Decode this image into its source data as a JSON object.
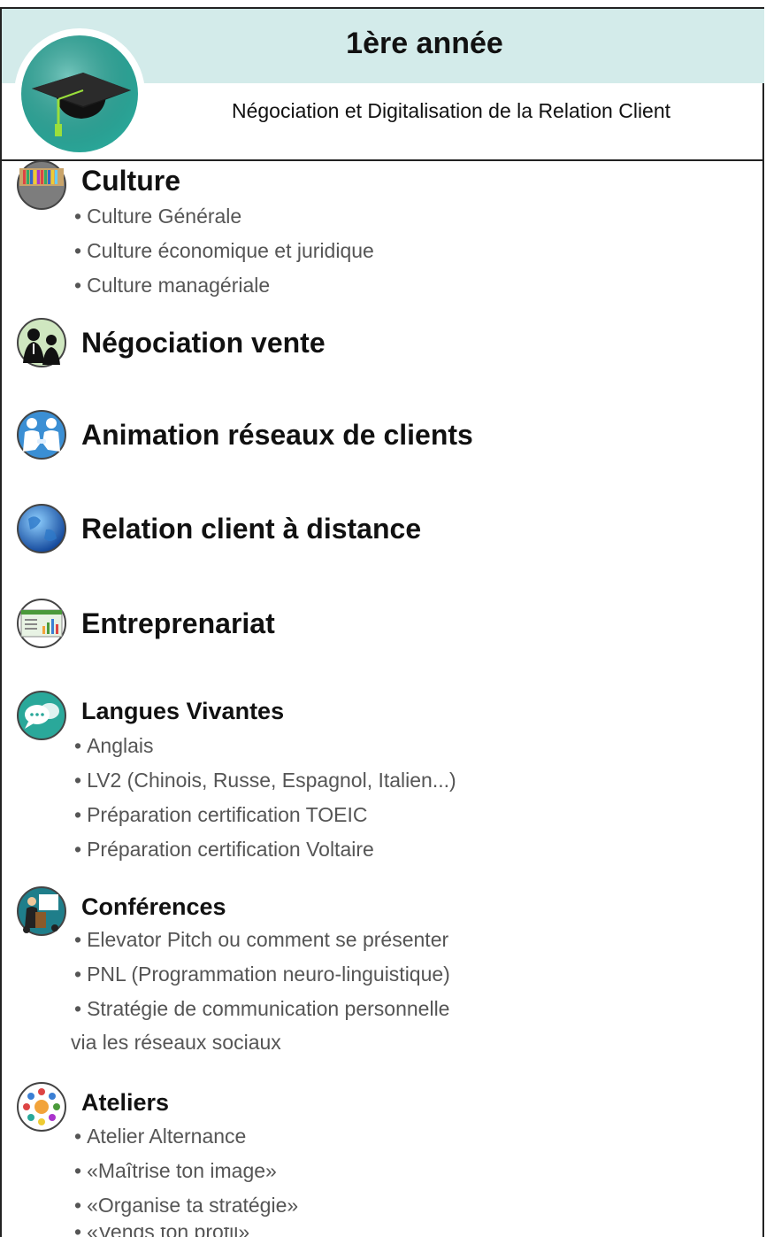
{
  "header": {
    "year": "1ère année",
    "program": "Négociation et Digitalisation de la Relation Client"
  },
  "logo": {
    "icon": "graduation-cap-icon"
  },
  "sections": [
    {
      "title": "Culture",
      "icon": "bookshelf-icon",
      "items": [
        "Culture Générale",
        "Culture économique et juridique",
        "Culture managériale"
      ]
    },
    {
      "title": "Négociation vente",
      "icon": "business-meeting-icon",
      "items": []
    },
    {
      "title": "Animation réseaux de clients",
      "icon": "handshake-icon",
      "items": []
    },
    {
      "title": "Relation client à distance",
      "icon": "globe-icon",
      "items": []
    },
    {
      "title": "Entreprenariat",
      "icon": "dashboard-screen-icon",
      "items": []
    },
    {
      "title": "Langues Vivantes",
      "icon": "speech-bubbles-icon",
      "items": [
        "Anglais",
        "LV2 (Chinois, Russe, Espagnol, Italien...)",
        "Préparation certification TOEIC",
        "Préparation certification Voltaire"
      ]
    },
    {
      "title": "Conférences",
      "icon": "presenter-icon",
      "items": [
        "Elevator Pitch ou comment se présenter",
        "PNL (Programmation neuro-linguistique)",
        "Stratégie de communication personnelle"
      ],
      "continuation": "via les réseaux sociaux"
    },
    {
      "title": "Ateliers",
      "icon": "team-circle-icon",
      "items": [
        "Atelier Alternance",
        "«Maîtrise ton image»",
        "«Organise ta stratégie»",
        "«Vends ton profil»"
      ]
    }
  ],
  "colors": {
    "header_band": "#d3ebea",
    "logo_ring": "#2aa89a",
    "text_muted": "#555555"
  }
}
